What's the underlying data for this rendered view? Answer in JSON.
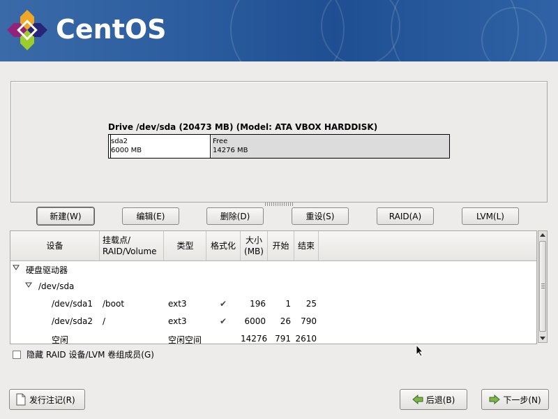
{
  "header": {
    "brand": "CentOS"
  },
  "drive": {
    "title": "Drive /dev/sda (20473 MB) (Model: ATA VBOX HARDDISK)",
    "segments": [
      {
        "name": "sda2",
        "size": "6000 MB"
      },
      {
        "name": "Free",
        "size": "14276 MB"
      }
    ]
  },
  "actions": {
    "new": "新建(W)",
    "edit": "编辑(E)",
    "delete": "删除(D)",
    "reset": "重设(S)",
    "raid": "RAID(A)",
    "lvm": "LVM(L)"
  },
  "table": {
    "headers": {
      "device": "设备",
      "mount": "挂载点/\nRAID/Volume",
      "type": "类型",
      "format": "格式化",
      "size": "大小\n(MB)",
      "start": "开始",
      "end": "结束"
    },
    "rows": [
      {
        "device": "硬盘驱动器",
        "mount": "",
        "type": "",
        "format": "",
        "size": "",
        "start": "",
        "end": ""
      },
      {
        "device": "/dev/sda",
        "mount": "",
        "type": "",
        "format": "",
        "size": "",
        "start": "",
        "end": ""
      },
      {
        "device": "/dev/sda1",
        "mount": "/boot",
        "type": "ext3",
        "format": "✔",
        "size": "196",
        "start": "1",
        "end": "25"
      },
      {
        "device": "/dev/sda2",
        "mount": "/",
        "type": "ext3",
        "format": "✔",
        "size": "6000",
        "start": "26",
        "end": "790"
      },
      {
        "device": "空闲",
        "mount": "",
        "type": "空闲空间",
        "format": "",
        "size": "14276",
        "start": "791",
        "end": "2610"
      }
    ]
  },
  "hide_option": "隐藏 RAID 设备/LVM 卷组成员(G)",
  "footer": {
    "release_notes": "发行注记(R)",
    "back": "后退(B)",
    "next": "下一步(N)"
  }
}
